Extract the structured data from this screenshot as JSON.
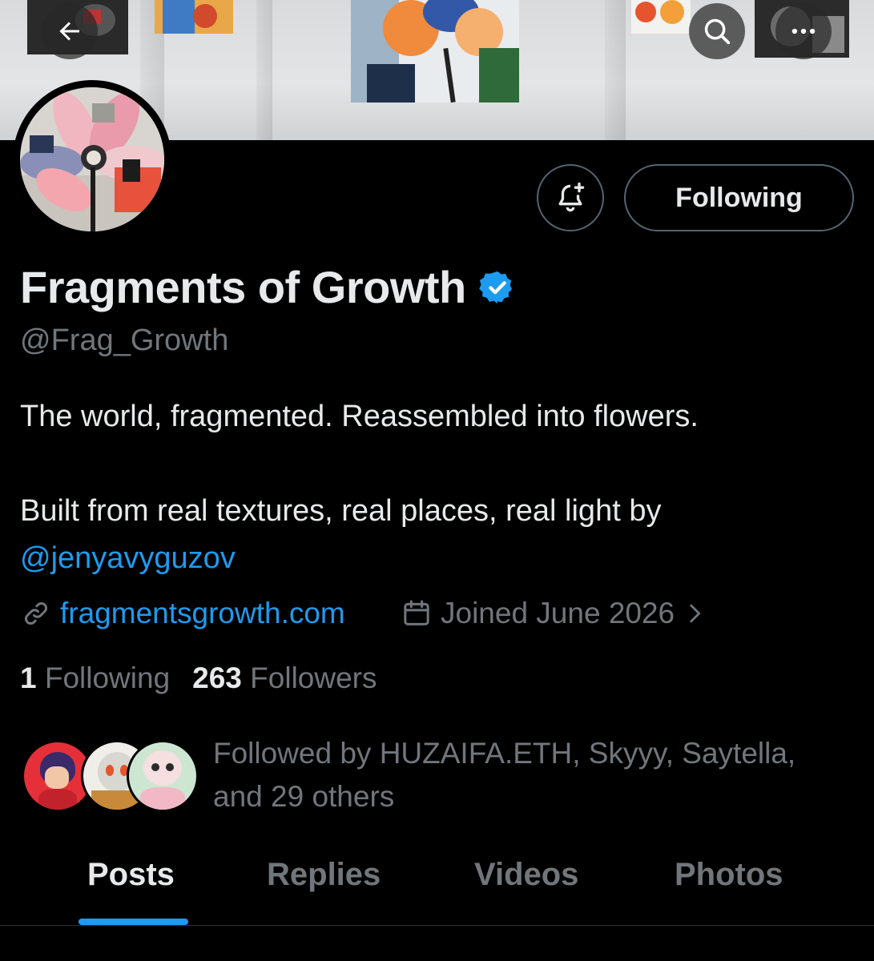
{
  "header": {
    "back_icon": "arrow-left-icon",
    "search_icon": "search-icon",
    "more_icon": "more-dots-icon"
  },
  "profile": {
    "name": "Fragments of Growth",
    "handle": "@Frag_Growth",
    "verified": true,
    "bio_line1": "The world, fragmented. Reassembled into flowers.",
    "bio_line2": "Built from real textures, real places, real light by",
    "bio_mention": "@jenyavyguzov",
    "website": "fragmentsgrowth.com",
    "joined": "Joined June 2026"
  },
  "actions": {
    "notify_icon": "bell-plus-icon",
    "following_label": "Following"
  },
  "stats": {
    "following_count": "1",
    "following_label": "Following",
    "followers_count": "263",
    "followers_label": "Followers"
  },
  "followed_by": {
    "line1": "Followed by HUZAIFA.ETH, Skyyy, Saytella,",
    "line2": "and 29 others"
  },
  "tabs": [
    {
      "label": "Posts",
      "active": true
    },
    {
      "label": "Replies",
      "active": false
    },
    {
      "label": "Videos",
      "active": false
    },
    {
      "label": "Photos",
      "active": false
    }
  ],
  "colors": {
    "accent": "#1d9bf0",
    "background": "#000000",
    "secondary_text": "#71767b",
    "primary_text": "#e7e9ea",
    "border": "#536471"
  }
}
